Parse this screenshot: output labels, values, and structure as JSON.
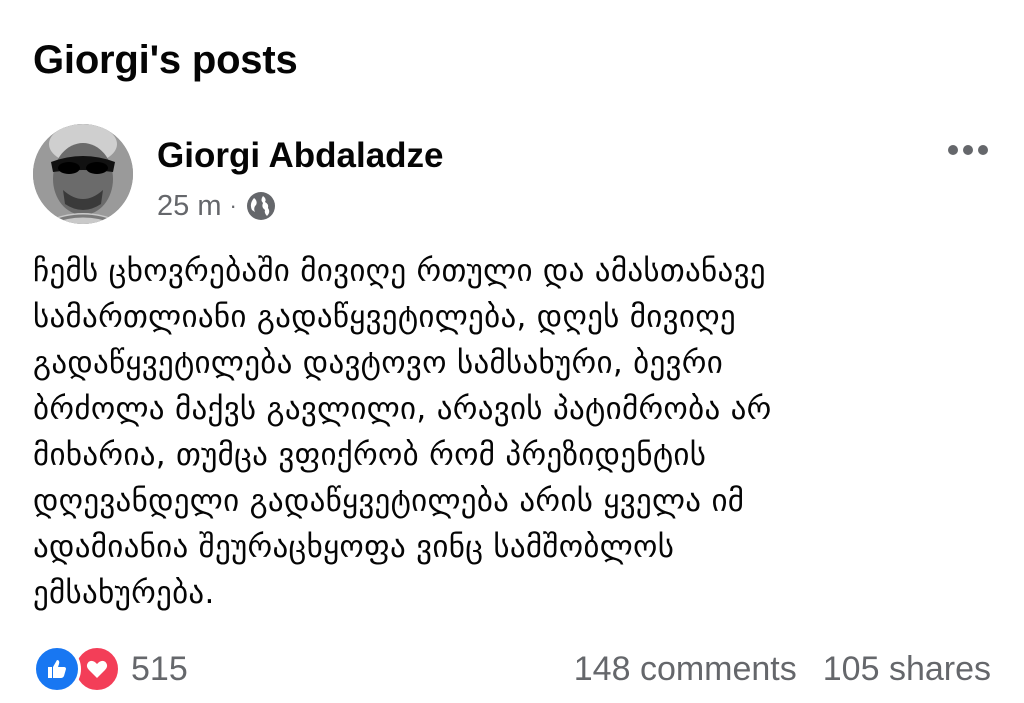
{
  "section_title": "Giorgi's posts",
  "post": {
    "author": "Giorgi Abdaladze",
    "time": "25 m",
    "separator": "·",
    "audience_icon": "globe-icon",
    "more_icon": "more-options-icon",
    "text": "ჩემს ცხოვრებაში მივიღე რთული და ამასთანავე\nსამართლიანი გადაწყვეტილება, დღეს მივიღე\nგადაწყვეტილება დავტოვო სამსახური,  ბევრი\nბრძოლა მაქვს გავლილი, არავის პატიმრობა არ\nმიხარია, თუმცა ვფიქრობ რომ პრეზიდენტის\nდღევანდელი გადაწყვეტილება არის ყველა იმ\nადამიანია შეურაცხყოფა ვინც სამშობლოს\nემსახურება.",
    "reactions": {
      "icons": [
        "like-icon",
        "love-icon"
      ],
      "count": "515"
    },
    "comments": "148 comments",
    "shares": "105 shares"
  },
  "colors": {
    "like": "#1877f2",
    "love": "#f33e58",
    "secondary_text": "#65676b"
  }
}
